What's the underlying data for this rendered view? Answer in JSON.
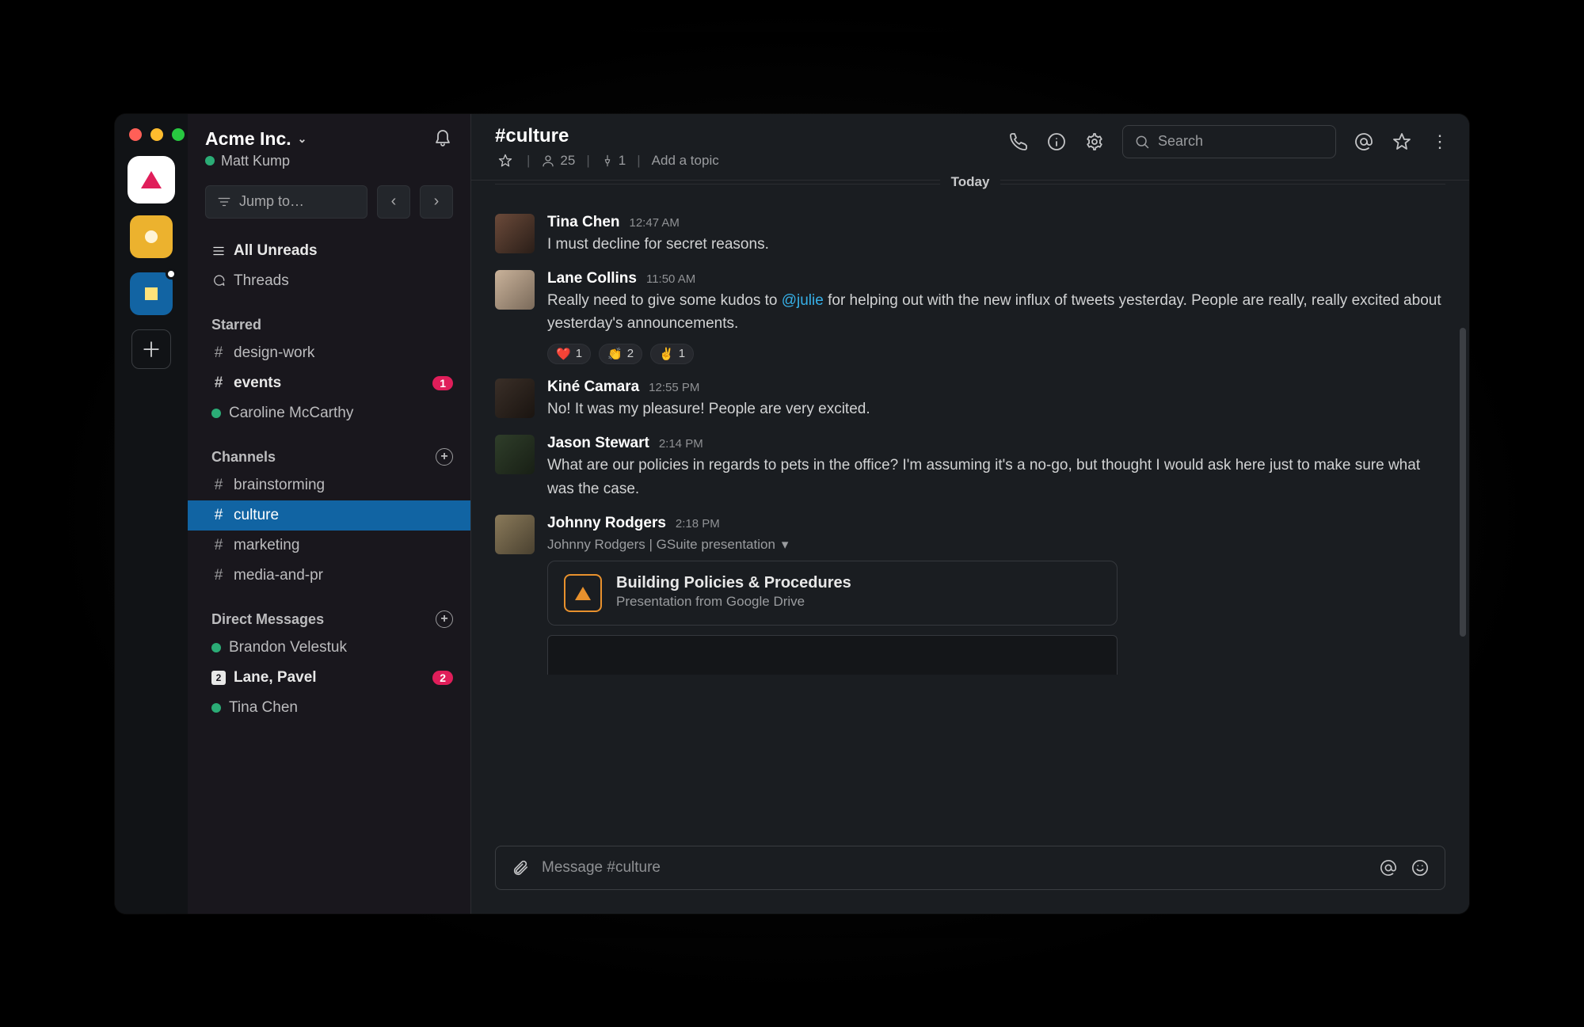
{
  "workspace": {
    "traffic": [
      "close",
      "minimize",
      "zoom"
    ],
    "workspaces": [
      "Acme",
      "Workspace 2",
      "Workspace 3"
    ]
  },
  "sidebar": {
    "team_name": "Acme Inc.",
    "user_name": "Matt Kump",
    "jump_to": "Jump to…",
    "all_unreads": "All Unreads",
    "threads": "Threads",
    "starred": {
      "label": "Starred",
      "items": [
        {
          "type": "channel",
          "name": "design-work",
          "bold": false,
          "badge": null
        },
        {
          "type": "channel",
          "name": "events",
          "bold": true,
          "badge": "1"
        },
        {
          "type": "dm",
          "name": "Caroline McCarthy",
          "presence": "active"
        }
      ]
    },
    "channels": {
      "label": "Channels",
      "items": [
        {
          "name": "brainstorming",
          "active": false
        },
        {
          "name": "culture",
          "active": true
        },
        {
          "name": "marketing",
          "active": false
        },
        {
          "name": "media-and-pr",
          "active": false
        }
      ]
    },
    "dms": {
      "label": "Direct Messages",
      "items": [
        {
          "name": "Brandon Velestuk",
          "presence": "active",
          "bold": false,
          "badge": null,
          "count_icon": null
        },
        {
          "name": "Lane, Pavel",
          "presence": null,
          "bold": true,
          "badge": "2",
          "count_icon": "2"
        },
        {
          "name": "Tina Chen",
          "presence": "active",
          "bold": false,
          "badge": null,
          "count_icon": null
        }
      ]
    }
  },
  "channel": {
    "name": "#culture",
    "member_count": "25",
    "pinned_count": "1",
    "add_topic": "Add a topic",
    "search_placeholder": "Search",
    "divider": "Today"
  },
  "messages": [
    {
      "author": "Tina Chen",
      "ts": "12:47 AM",
      "text": "I must decline for secret reasons.",
      "avatar": "a1"
    },
    {
      "author": "Lane Collins",
      "ts": "11:50 AM",
      "text_prefix": "Really need to give some kudos to ",
      "mention": "@julie",
      "text_suffix": " for helping out with the new influx of tweets yesterday. People are really, really excited about yesterday's announcements.",
      "avatar": "a2",
      "reactions": [
        {
          "emoji": "❤️",
          "count": "1"
        },
        {
          "emoji": "👏",
          "count": "2"
        },
        {
          "emoji": "✌️",
          "count": "1"
        }
      ]
    },
    {
      "author": "Kiné Camara",
      "ts": "12:55 PM",
      "text": "No! It was my pleasure! People are very excited.",
      "avatar": "a3"
    },
    {
      "author": "Jason Stewart",
      "ts": "2:14 PM",
      "text": "What are our policies in regards to pets in the office? I'm assuming it's a no-go, but thought I would ask here just to make sure what was the case.",
      "avatar": "a4"
    },
    {
      "author": "Johnny Rodgers",
      "ts": "2:18 PM",
      "context": "Johnny Rodgers | GSuite presentation",
      "attachment": {
        "title": "Building Policies & Procedures",
        "subtitle": "Presentation from Google Drive"
      },
      "avatar": "a5"
    }
  ],
  "composer": {
    "placeholder": "Message #culture"
  }
}
